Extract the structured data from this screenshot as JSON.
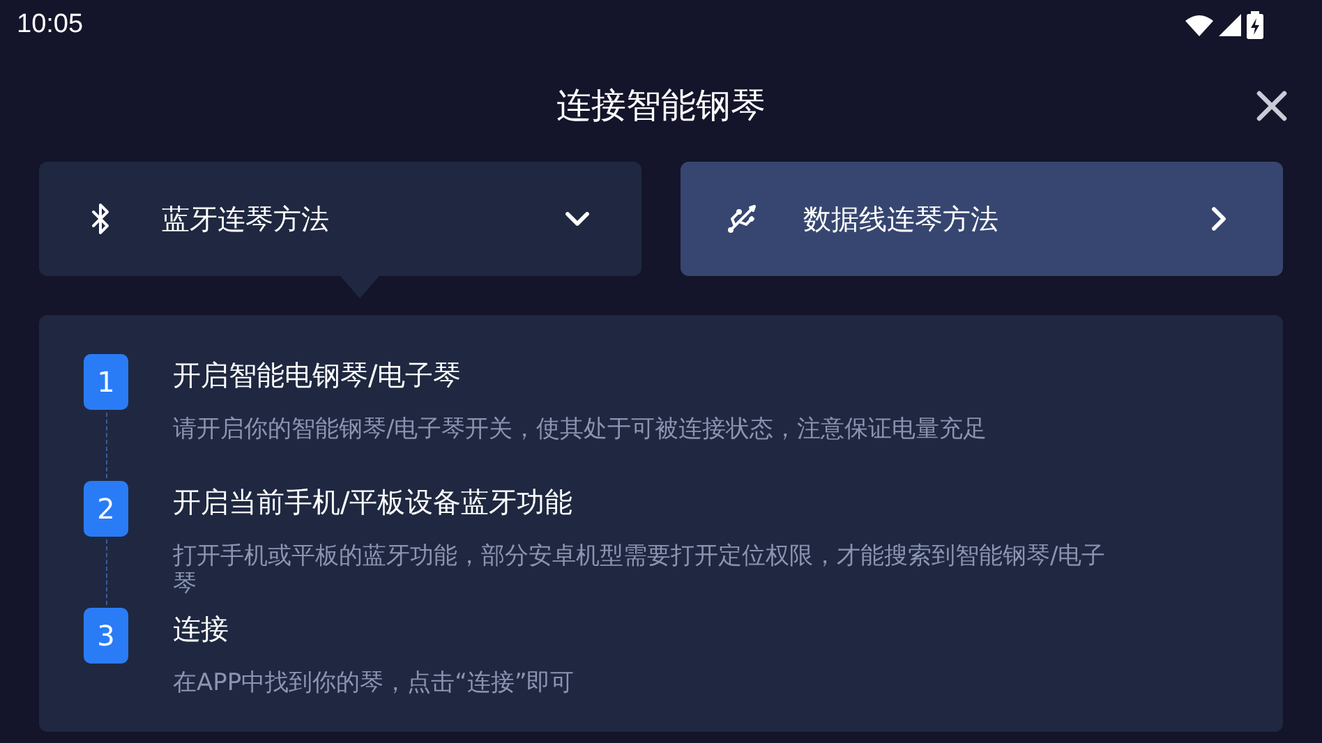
{
  "status_bar": {
    "time": "10:05"
  },
  "header": {
    "title": "连接智能钢琴"
  },
  "tabs": [
    {
      "kind": "bluetooth",
      "label": "蓝牙连琴方法",
      "selected": true
    },
    {
      "kind": "usb",
      "label": "数据线连琴方法",
      "selected": false
    }
  ],
  "steps": [
    {
      "number": "1",
      "title": "开启智能电钢琴/电子琴",
      "description": "请开启你的智能钢琴/电子琴开关，使其处于可被连接状态，注意保证电量充足"
    },
    {
      "number": "2",
      "title": "开启当前手机/平板设备蓝牙功能",
      "description": "打开手机或平板的蓝牙功能，部分安卓机型需要打开定位权限，才能搜索到智能钢琴/电子琴"
    },
    {
      "number": "3",
      "title": "连接",
      "description": "在APP中找到你的琴，点击“连接”即可"
    }
  ]
}
